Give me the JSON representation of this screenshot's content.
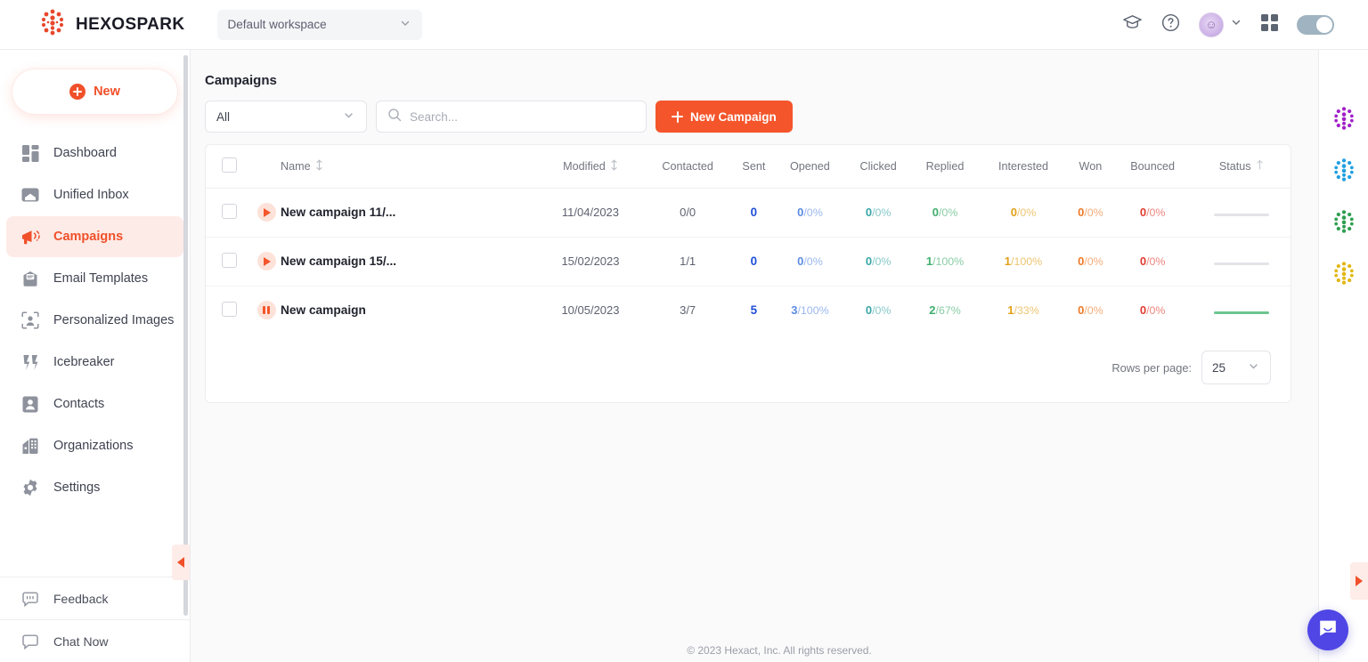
{
  "topbar": {
    "brand_name": "HEXOSPARK",
    "logo_icon": "hexospark-hex-dots-logo",
    "workspace": {
      "value": "Default workspace",
      "chevron_icon": "chevron-down-icon"
    },
    "icons": {
      "academy": "graduation-cap-icon",
      "help": "question-circle-icon",
      "avatar": "user-avatar",
      "avatar_chevron": "chevron-down-icon",
      "apps": "grid-apps-icon",
      "theme_toggle": "toggle-switch"
    }
  },
  "sidebar": {
    "new_button": {
      "label": "New",
      "icon": "plus-circle-icon"
    },
    "items": [
      {
        "label": "Dashboard",
        "icon": "dashboard-icon",
        "active": false
      },
      {
        "label": "Unified Inbox",
        "icon": "inbox-icon",
        "active": false
      },
      {
        "label": "Campaigns",
        "icon": "megaphone-icon",
        "active": true
      },
      {
        "label": "Email Templates",
        "icon": "email-template-icon",
        "active": false
      },
      {
        "label": "Personalized Images",
        "icon": "personalized-image-icon",
        "active": false
      },
      {
        "label": "Icebreaker",
        "icon": "icebreaker-icon",
        "active": false
      },
      {
        "label": "Contacts",
        "icon": "contact-icon",
        "active": false
      },
      {
        "label": "Organizations",
        "icon": "organization-icon",
        "active": false
      },
      {
        "label": "Settings",
        "icon": "gear-icon",
        "active": false
      }
    ],
    "bottom_items": [
      {
        "label": "Feedback",
        "icon": "feedback-icon"
      },
      {
        "label": "Chat Now",
        "icon": "chat-icon"
      }
    ],
    "collapse_icon": "triangle-left-icon"
  },
  "main": {
    "page_title": "Campaigns",
    "toolbar": {
      "filter": {
        "value": "All",
        "chevron_icon": "chevron-down-icon"
      },
      "search": {
        "placeholder": "Search...",
        "value": "",
        "icon": "search-icon"
      },
      "new_campaign": {
        "label": "New Campaign",
        "icon": "plus-icon"
      }
    },
    "table": {
      "columns": [
        {
          "label": "Name",
          "sortable": true,
          "sort_icon": "sort-arrows-icon"
        },
        {
          "label": "Modified",
          "sortable": true,
          "sort_icon": "sort-arrows-icon"
        },
        {
          "label": "Contacted",
          "sortable": false
        },
        {
          "label": "Sent",
          "sortable": false
        },
        {
          "label": "Opened",
          "sortable": false
        },
        {
          "label": "Clicked",
          "sortable": false
        },
        {
          "label": "Replied",
          "sortable": false
        },
        {
          "label": "Interested",
          "sortable": false
        },
        {
          "label": "Won",
          "sortable": false
        },
        {
          "label": "Bounced",
          "sortable": false
        },
        {
          "label": "Status",
          "sortable": true,
          "sort_icon": "sort-arrow-up-icon"
        }
      ],
      "header_checkbox": {
        "checked": false,
        "icon": "checkbox-icon"
      },
      "rows": [
        {
          "checkbox": false,
          "state_icon": "play-icon",
          "name": "New campaign 11/...",
          "modified": "11/04/2023",
          "contacted": "0/0",
          "sent": "0",
          "opened": {
            "n": "0",
            "p": "/0%"
          },
          "clicked": {
            "n": "0",
            "p": "/0%"
          },
          "replied": {
            "n": "0",
            "p": "/0%"
          },
          "interested": {
            "n": "0",
            "p": "/0%"
          },
          "won": {
            "n": "0",
            "p": "/0%"
          },
          "bounced": {
            "n": "0",
            "p": "/0%"
          },
          "status_bar": "inactive"
        },
        {
          "checkbox": false,
          "state_icon": "play-icon",
          "name": "New campaign 15/...",
          "modified": "15/02/2023",
          "contacted": "1/1",
          "sent": "0",
          "opened": {
            "n": "0",
            "p": "/0%"
          },
          "clicked": {
            "n": "0",
            "p": "/0%"
          },
          "replied": {
            "n": "1",
            "p": "/100%"
          },
          "interested": {
            "n": "1",
            "p": "/100%"
          },
          "won": {
            "n": "0",
            "p": "/0%"
          },
          "bounced": {
            "n": "0",
            "p": "/0%"
          },
          "status_bar": "inactive"
        },
        {
          "checkbox": false,
          "state_icon": "pause-icon",
          "name": "New campaign",
          "modified": "10/05/2023",
          "contacted": "3/7",
          "sent": "5",
          "opened": {
            "n": "3",
            "p": "/100%"
          },
          "clicked": {
            "n": "0",
            "p": "/0%"
          },
          "replied": {
            "n": "2",
            "p": "/67%"
          },
          "interested": {
            "n": "1",
            "p": "/33%"
          },
          "won": {
            "n": "0",
            "p": "/0%"
          },
          "bounced": {
            "n": "0",
            "p": "/0%"
          },
          "status_bar": "active"
        }
      ]
    },
    "pagination": {
      "rows_per_page_label": "Rows per page:",
      "rows_per_page_value": "25",
      "chevron_icon": "chevron-down-icon"
    },
    "copyright": "© 2023 Hexact, Inc. All rights reserved."
  },
  "right_rail": {
    "products": [
      {
        "name": "hexomatic-logo",
        "color": "#a020c8"
      },
      {
        "name": "hexowatch-logo",
        "color": "#1f9fe0"
      },
      {
        "name": "hexometer-logo",
        "color": "#2e9e4f"
      },
      {
        "name": "hexofy-logo",
        "color": "#e2b714"
      }
    ],
    "expand_icon": "triangle-right-icon",
    "chat_widget_icon": "intercom-chat-icon"
  },
  "colors": {
    "brand_orange": "#f4552b",
    "sent_blue": "#1f4fd8",
    "opened": "#5b8ce4",
    "clicked": "#3aa6a6",
    "replied": "#3fae6d",
    "interested": "#e3a119",
    "won": "#ef7a28",
    "bounced": "#e03b30",
    "status_active": "#6cc58f",
    "status_inactive": "#e3e4e8"
  }
}
